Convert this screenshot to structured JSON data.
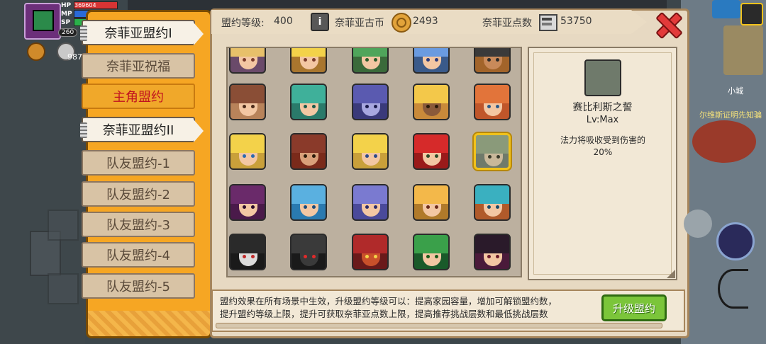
{
  "hud": {
    "hp_label": "HP",
    "hp_value": "369604",
    "mp_label": "MP",
    "sp_label": "SP",
    "level": "260",
    "gold_partial": "987"
  },
  "sidebar": {
    "tabs": [
      {
        "label": "奈菲亚盟约I",
        "state": "selected"
      },
      {
        "label": "奈菲亚祝福",
        "state": "normal"
      },
      {
        "label": "主角盟约",
        "state": "highlight"
      },
      {
        "label": "奈菲亚盟约II",
        "state": "selected-alt"
      },
      {
        "label": "队友盟约-1",
        "state": "normal"
      },
      {
        "label": "队友盟约-2",
        "state": "normal"
      },
      {
        "label": "队友盟约-3",
        "state": "normal"
      },
      {
        "label": "队友盟约-4",
        "state": "normal"
      },
      {
        "label": "队友盟约-5",
        "state": "normal"
      }
    ]
  },
  "topbar": {
    "level_label": "盟约等级:",
    "level_value": "400",
    "coin_label": "奈菲亚古币",
    "coin_value": "2493",
    "points_label": "奈菲亚点数",
    "points_value": "53750"
  },
  "detail": {
    "name": "赛比利斯之誓",
    "level": "Lv:Max",
    "desc_line1": "法力将吸收受到伤害的",
    "desc_line2": "20%"
  },
  "bottom": {
    "line1": "盟约效果在所有场景中生效，升级盟约等级可以：提高家园容量，增加可解锁盟约数，",
    "line2": "提升盟约等级上限，提升可获取奈菲亚点数上限，提高推荐挑战层数和最低挑战层数",
    "upgrade_label": "升级盟约"
  },
  "map": {
    "town_label": "小城",
    "quest_text": "尔维斯证明先知骗"
  },
  "colors": {
    "accent_orange": "#f6a623",
    "panel_bg": "#e7d9c2",
    "upgrade_green": "#7bc53a",
    "close_red": "#e23a3a",
    "selected_gold": "#f1c21b"
  },
  "portraits": [
    {
      "row": 0,
      "col": 0,
      "hair": "#e7c06a",
      "skin": "#f3c7a3",
      "eye": "#7a3b2a",
      "bg": "#6a4a6a"
    },
    {
      "row": 0,
      "col": 1,
      "hair": "#f3d24a",
      "skin": "#f3c7a3",
      "eye": "#7a3b2a",
      "bg": "#a9762e"
    },
    {
      "row": 0,
      "col": 2,
      "hair": "#4fa55b",
      "skin": "#f3c7a3",
      "eye": "#2a5a2a",
      "bg": "#3a6a3a"
    },
    {
      "row": 0,
      "col": 3,
      "hair": "#6a9be0",
      "skin": "#f3c7a3",
      "eye": "#2a3a7a",
      "bg": "#3a5a8a"
    },
    {
      "row": 0,
      "col": 4,
      "hair": "#3a3a3a",
      "skin": "#c98a5a",
      "eye": "#2a2a2a",
      "bg": "#a2642a"
    },
    {
      "row": 1,
      "col": 0,
      "hair": "#8a4e36",
      "skin": "#f3c7a3",
      "eye": "#4a2a1a",
      "bg": "#b8835a"
    },
    {
      "row": 1,
      "col": 1,
      "hair": "#3fb09a",
      "skin": "#f3c7a3",
      "eye": "#1a5a4a",
      "bg": "#2a7a6a"
    },
    {
      "row": 1,
      "col": 2,
      "hair": "#5a5ab0",
      "skin": "#a8a8e0",
      "eye": "#1a1a4a",
      "bg": "#3a3a7a"
    },
    {
      "row": 1,
      "col": 3,
      "hair": "#f3c84a",
      "skin": "#8a5a3a",
      "eye": "#2a1a0a",
      "bg": "#c98a3a"
    },
    {
      "row": 1,
      "col": 4,
      "hair": "#e2743a",
      "skin": "#f3c7a3",
      "eye": "#2a5a8a",
      "bg": "#c0562a"
    },
    {
      "row": 2,
      "col": 0,
      "hair": "#f3d24a",
      "skin": "#f3c7a3",
      "eye": "#2a6ab0",
      "bg": "#c9a03a"
    },
    {
      "row": 2,
      "col": 1,
      "hair": "#8a3a2a",
      "skin": "#d9a07a",
      "eye": "#2a1a0a",
      "bg": "#7a2a1a"
    },
    {
      "row": 2,
      "col": 2,
      "hair": "#f3d24a",
      "skin": "#f3c7a3",
      "eye": "#2a4a8a",
      "bg": "#c9a03a"
    },
    {
      "row": 2,
      "col": 3,
      "hair": "#d62a2a",
      "skin": "#f3c7a3",
      "eye": "#2a4a2a",
      "bg": "#9a1a1a"
    },
    {
      "row": 2,
      "col": 4,
      "hair": "#8a9a7a",
      "skin": "#c9b89a",
      "eye": "#3a3a2a",
      "bg": "#6f7a6b",
      "selected": true
    },
    {
      "row": 3,
      "col": 0,
      "hair": "#6a2a6a",
      "skin": "#f3c7a3",
      "eye": "#2a0a2a",
      "bg": "#4a1a4a"
    },
    {
      "row": 3,
      "col": 1,
      "hair": "#5ab0e0",
      "skin": "#f3c7a3",
      "eye": "#1a4a7a",
      "bg": "#2a7ab0"
    },
    {
      "row": 3,
      "col": 2,
      "hair": "#7a7ad0",
      "skin": "#f3c7a3",
      "eye": "#2a2a6a",
      "bg": "#4a4a9a"
    },
    {
      "row": 3,
      "col": 3,
      "hair": "#f3b84a",
      "skin": "#f3c7a3",
      "eye": "#6a2a1a",
      "bg": "#b07a2a"
    },
    {
      "row": 3,
      "col": 4,
      "hair": "#3ab0c0",
      "skin": "#f3c7a3",
      "eye": "#1a4a6a",
      "bg": "#b05a2a"
    },
    {
      "row": 4,
      "col": 0,
      "hair": "#2a2a2a",
      "skin": "#dcdcdc",
      "eye": "#c22a2a",
      "bg": "#1a1a1a"
    },
    {
      "row": 4,
      "col": 1,
      "hair": "#3a3a3a",
      "skin": "#3a3a3a",
      "eye": "#e22a2a",
      "bg": "#1a1a1a"
    },
    {
      "row": 4,
      "col": 2,
      "hair": "#b02a2a",
      "skin": "#c9502a",
      "eye": "#f3d24a",
      "bg": "#6a1a1a"
    },
    {
      "row": 4,
      "col": 3,
      "hair": "#3aa04a",
      "skin": "#f3c7a3",
      "eye": "#1a5a1a",
      "bg": "#1a5a2a"
    },
    {
      "row": 4,
      "col": 4,
      "hair": "#2a1a2a",
      "skin": "#f3c7a3",
      "eye": "#6a1a2a",
      "bg": "#4a1a3a"
    }
  ]
}
